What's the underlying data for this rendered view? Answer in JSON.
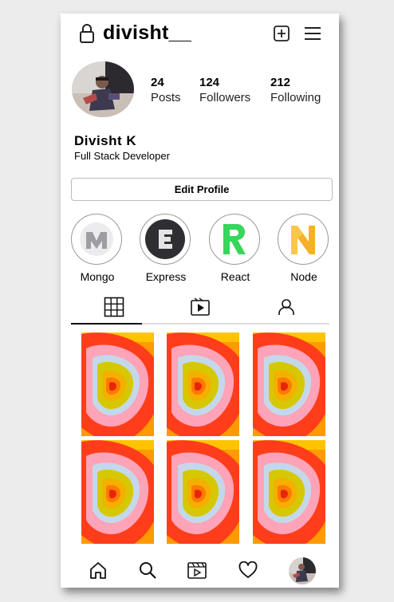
{
  "header": {
    "username": "divisht__",
    "icons": [
      "lock-icon",
      "add-post-icon",
      "menu-icon"
    ]
  },
  "profile": {
    "stats": [
      {
        "value": "24",
        "label": "Posts"
      },
      {
        "value": "124",
        "label": "Followers"
      },
      {
        "value": "212",
        "label": "Following"
      }
    ],
    "name": "Divisht K",
    "bio": "Full Stack Developer",
    "edit_label": "Edit Profile"
  },
  "highlights": [
    {
      "label": "Mongo",
      "letter": "M",
      "color": "#a8a8ad"
    },
    {
      "label": "Express",
      "letter": "E",
      "color": "#333333"
    },
    {
      "label": "React",
      "letter": "R",
      "color": "#3ddc5a"
    },
    {
      "label": "Node",
      "letter": "N",
      "color": "#f7a823"
    }
  ],
  "tabs": [
    "grid-icon",
    "reels-icon",
    "tagged-icon"
  ],
  "bottom_nav": [
    "home-icon",
    "search-icon",
    "reels-icon",
    "heart-icon",
    "profile-avatar"
  ],
  "colors": {
    "accent": "#000000",
    "post_outer": "#ff3d1a",
    "post_mid": "#ffa0b4",
    "post_core": "#d4c400"
  }
}
